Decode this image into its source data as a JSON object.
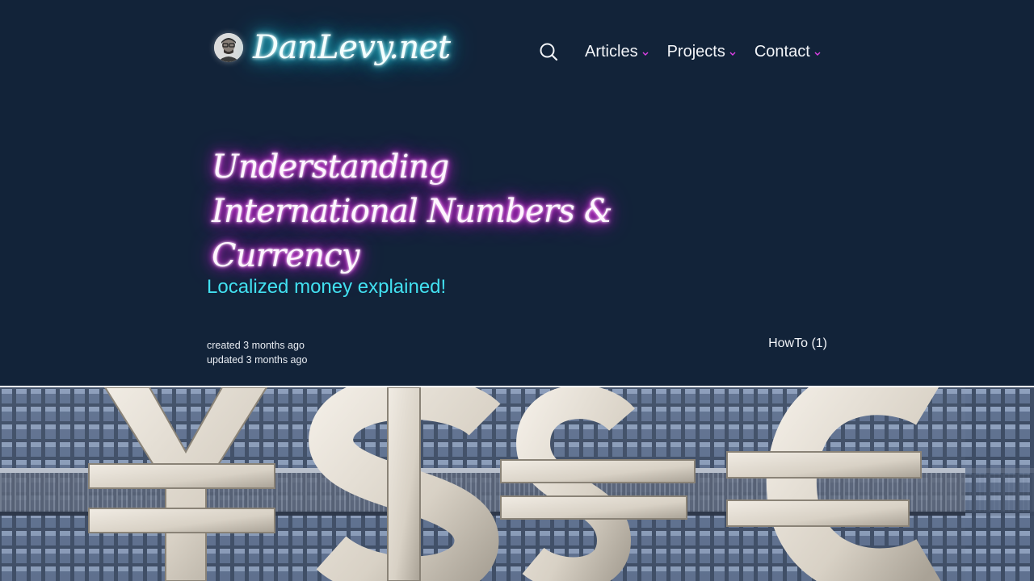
{
  "header": {
    "logo_text": "DanLevy.net",
    "avatar_icon": "avatar-portrait",
    "search_icon": "search-icon",
    "nav": [
      {
        "label": "Articles"
      },
      {
        "label": "Projects"
      },
      {
        "label": "Contact"
      }
    ],
    "accent_colors": {
      "logo_glow": "#22d6f0",
      "title_glow": "#e01ee8",
      "chevron": "#e040e8"
    }
  },
  "article": {
    "title": "Understanding International Numbers & Currency",
    "subtitle": "Localized money explained!",
    "created": "created 3 months ago",
    "updated": "updated 3 months ago",
    "tag": "HowTo (1)"
  },
  "hero_image": {
    "description_icon": "currency-symbols-image",
    "symbols": [
      "¥",
      "$",
      "$",
      "€"
    ]
  },
  "colors": {
    "background": "#122339",
    "subtitle": "#42e0f0",
    "text": "#f2f4f8"
  }
}
